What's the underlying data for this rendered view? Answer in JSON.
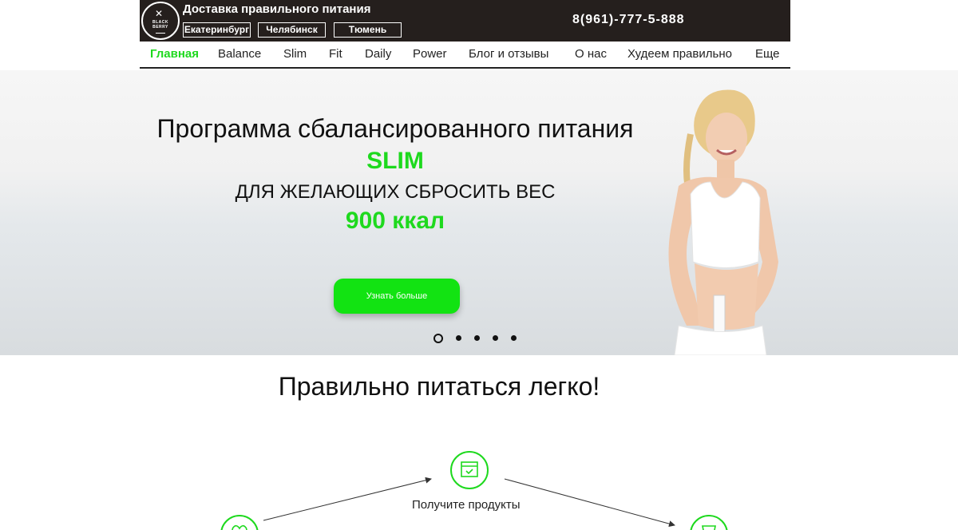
{
  "header": {
    "logo": {
      "line1": "BLACK",
      "line2": "BERRY"
    },
    "title": "Доставка правильного питания",
    "cities": [
      "Екатеринбург",
      "Челябинск",
      "Тюмень"
    ],
    "phone": "8(961)-777-5-888"
  },
  "nav": {
    "items": [
      {
        "label": "Главная",
        "active": true
      },
      {
        "label": "Balance"
      },
      {
        "label": "Slim"
      },
      {
        "label": "Fit"
      },
      {
        "label": "Daily"
      },
      {
        "label": "Power"
      },
      {
        "label": "Блог и отзывы"
      },
      {
        "label": "О нас"
      },
      {
        "label": "Худеем правильно"
      },
      {
        "label": "Еще"
      }
    ]
  },
  "hero": {
    "line1": "Программа сбалансированного питания",
    "line2": "SLIM",
    "line3": "ДЛЯ ЖЕЛАЮЩИХ СБРОСИТЬ ВЕС",
    "line4": "900 ккал",
    "cta": "Узнать больше",
    "slides": {
      "count": 5,
      "active": 1
    }
  },
  "section": {
    "title": "Правильно питаться легко!",
    "steps": [
      {
        "label": "Получите продукты",
        "icon": "box-icon"
      },
      {
        "icon": "heart-icon"
      },
      {
        "icon": "cup-icon"
      }
    ]
  },
  "colors": {
    "accent": "#1ed91e",
    "header_bg": "#251f1d"
  }
}
